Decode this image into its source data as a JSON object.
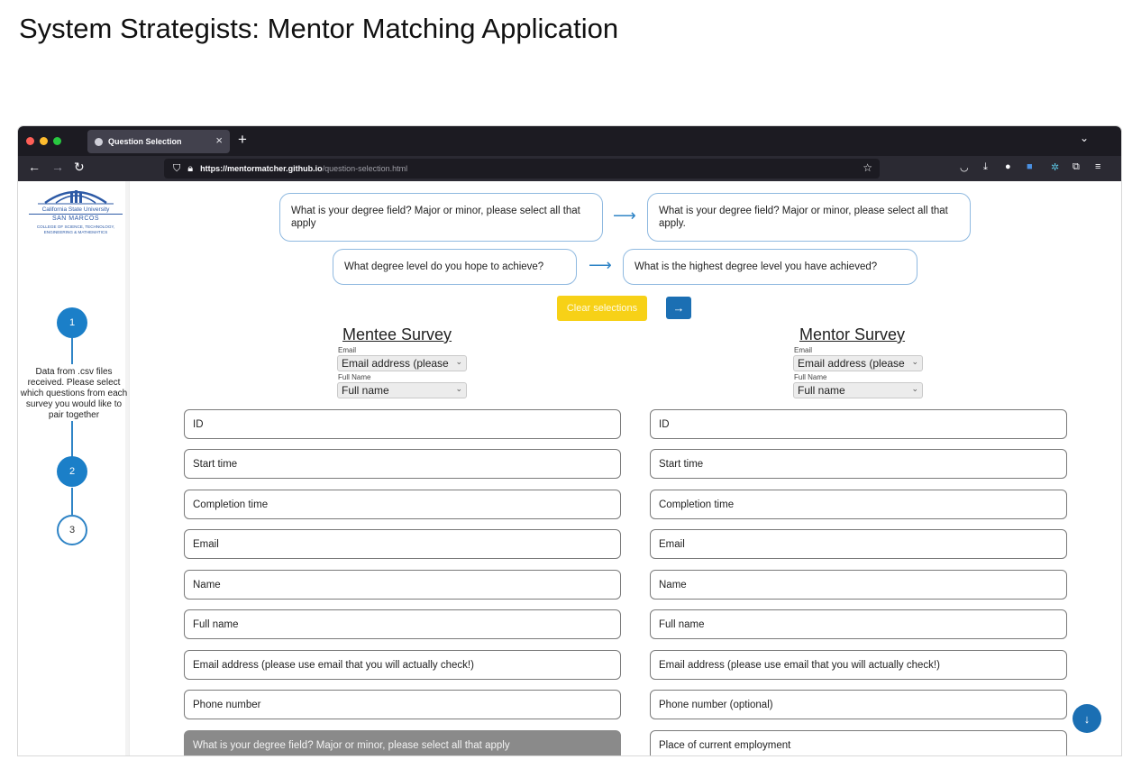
{
  "slide": {
    "title": "System Strategists: Mentor Matching Application"
  },
  "browser": {
    "tab_title": "Question Selection",
    "tab_close": "×",
    "new_tab": "+",
    "tab_list": "⌄",
    "url_host": "https://mentormatcher.github.io",
    "url_path": "/question-selection.html",
    "back": "←",
    "forward": "→",
    "reload": "↻",
    "bookmark_star": "☆",
    "menu": "≡"
  },
  "sidebar": {
    "logo": {
      "university": "California State University",
      "campus": "SAN MARCOS",
      "college_line1": "COLLEGE OF SCIENCE, TECHNOLOGY,",
      "college_line2": "ENGINEERING & MATHEMATICS"
    },
    "steps": [
      {
        "number": "1",
        "state": "active"
      },
      {
        "number": "2",
        "state": "active"
      },
      {
        "number": "3",
        "state": "inactive"
      }
    ],
    "step_description": "Data from .csv files received. Please select which questions from each survey you would like to pair together"
  },
  "pairs": [
    {
      "mentee": "What is your degree field? Major or minor, please select all that apply",
      "mentor": "What is your degree field? Major or minor, please select all that apply."
    },
    {
      "mentee": "What degree level do you hope to achieve?",
      "mentor": "What is the highest degree level you have achieved?"
    }
  ],
  "pair_arrow": "⟶",
  "actions": {
    "clear": "Clear selections",
    "next": "→"
  },
  "mentee": {
    "title": "Mentee Survey",
    "email_label": "Email",
    "email_value": "Email address (please",
    "fullname_label": "Full Name",
    "fullname_value": "Full name",
    "fields": [
      "ID",
      "Start time",
      "Completion time",
      "Email",
      "Name",
      "Full name",
      "Email address (please use email that you will actually check!)",
      "Phone number",
      "What is your degree field? Major or minor, please select all that apply"
    ],
    "selected_index": 8
  },
  "mentor": {
    "title": "Mentor Survey",
    "email_label": "Email",
    "email_value": "Email address (please",
    "fullname_label": "Full Name",
    "fullname_value": "Full name",
    "fields": [
      "ID",
      "Start time",
      "Completion time",
      "Email",
      "Name",
      "Full name",
      "Email address (please use email that you will actually check!)",
      "Phone number (optional)",
      "Place of current employment"
    ]
  },
  "scroll_down": "↓",
  "colors": {
    "accent_blue": "#1b7fc8",
    "clear_yellow": "#f7d117",
    "selected_gray": "#8a8a8a"
  }
}
